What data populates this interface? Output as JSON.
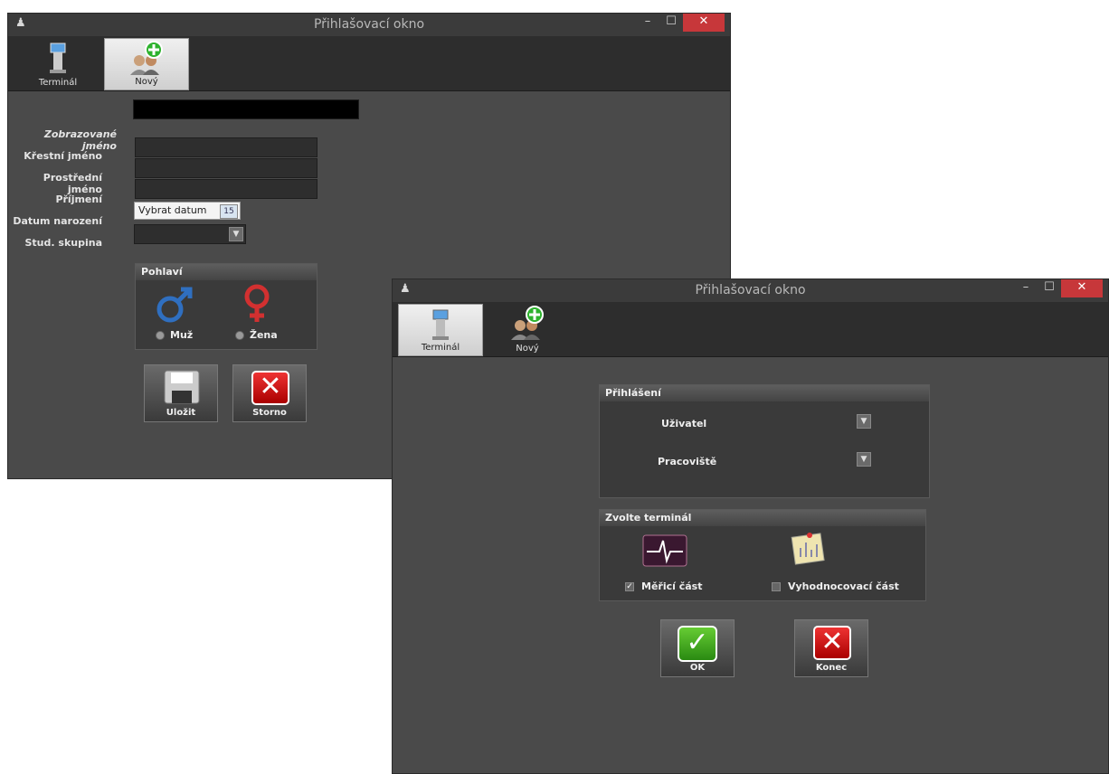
{
  "window_new": {
    "title": "Přihlašovací okno",
    "controls": {
      "minimize": "–",
      "maximize": "☐",
      "close": "✕"
    },
    "toolbar": {
      "terminal_label": "Terminál",
      "new_label": "Nový"
    },
    "display_name_label": "Zobrazované jméno",
    "display_name_value": "",
    "first_name_label": "Křestní jméno",
    "middle_name_label": "Prostřední jméno",
    "last_name_label": "Příjmení",
    "birth_date_label": "Datum narození",
    "birth_date_placeholder": "Vybrat datum",
    "calendar_glyph": "15",
    "group_label": "Stud. skupina",
    "gender": {
      "title": "Pohlaví",
      "male_label": "Muž",
      "female_label": "Žena"
    },
    "save_label": "Uložit",
    "cancel_label": "Storno"
  },
  "window_login": {
    "title": "Přihlašovací okno",
    "controls": {
      "minimize": "–",
      "maximize": "☐",
      "close": "✕"
    },
    "toolbar": {
      "terminal_label": "Terminál",
      "new_label": "Nový"
    },
    "login": {
      "title": "Přihlášení",
      "user_label": "Uživatel",
      "workplace_label": "Pracoviště"
    },
    "terminal": {
      "title": "Zvolte terminál",
      "measure_label": "Měřicí část",
      "measure_checked": true,
      "eval_label": "Vyhodnocovací část",
      "eval_checked": false
    },
    "ok_label": "OK",
    "exit_label": "Konec"
  },
  "colors": {
    "window_bg": "#4a4a4a",
    "toolbar_bg": "#2d2d2d",
    "close_red": "#c7373a",
    "male_blue": "#2f6fc0",
    "female_red": "#d23030"
  },
  "icons": [
    "kiosk-terminal-icon",
    "add-user-icon",
    "male-symbol-icon",
    "female-symbol-icon",
    "floppy-disk-icon",
    "close-x-icon",
    "check-icon",
    "ecg-monitor-icon",
    "chart-note-icon",
    "calendar-icon",
    "chevron-down-icon"
  ]
}
